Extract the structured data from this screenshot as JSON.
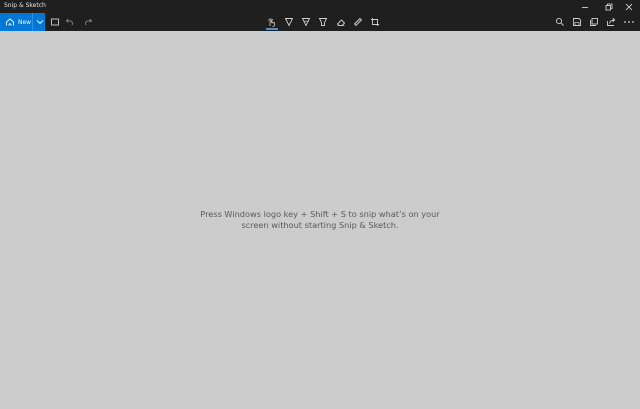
{
  "app": {
    "title": "Snip & Sketch"
  },
  "window_controls": [
    "minimize",
    "restore",
    "close"
  ],
  "toolbar": {
    "new_label": "New",
    "left_icons": [
      "delay-snip-icon",
      "undo-icon",
      "redo-icon"
    ],
    "center_tools": [
      "touch-writing-icon",
      "ballpoint-pen-icon",
      "pencil-icon",
      "highlighter-icon",
      "eraser-icon",
      "ruler-icon",
      "crop-icon"
    ],
    "active_tool": "touch-writing-icon",
    "right_icons": [
      "zoom-icon",
      "save-icon",
      "copy-icon",
      "share-icon",
      "more-icon"
    ]
  },
  "canvas": {
    "hint_line1": "Press Windows logo key + Shift + S to snip what’s on your",
    "hint_line2": "screen without starting Snip & Sketch."
  },
  "colors": {
    "chrome": "#1f1f1f",
    "accent": "#0078d7",
    "canvas": "#cccccc",
    "hint_text": "#5a5a5a"
  }
}
